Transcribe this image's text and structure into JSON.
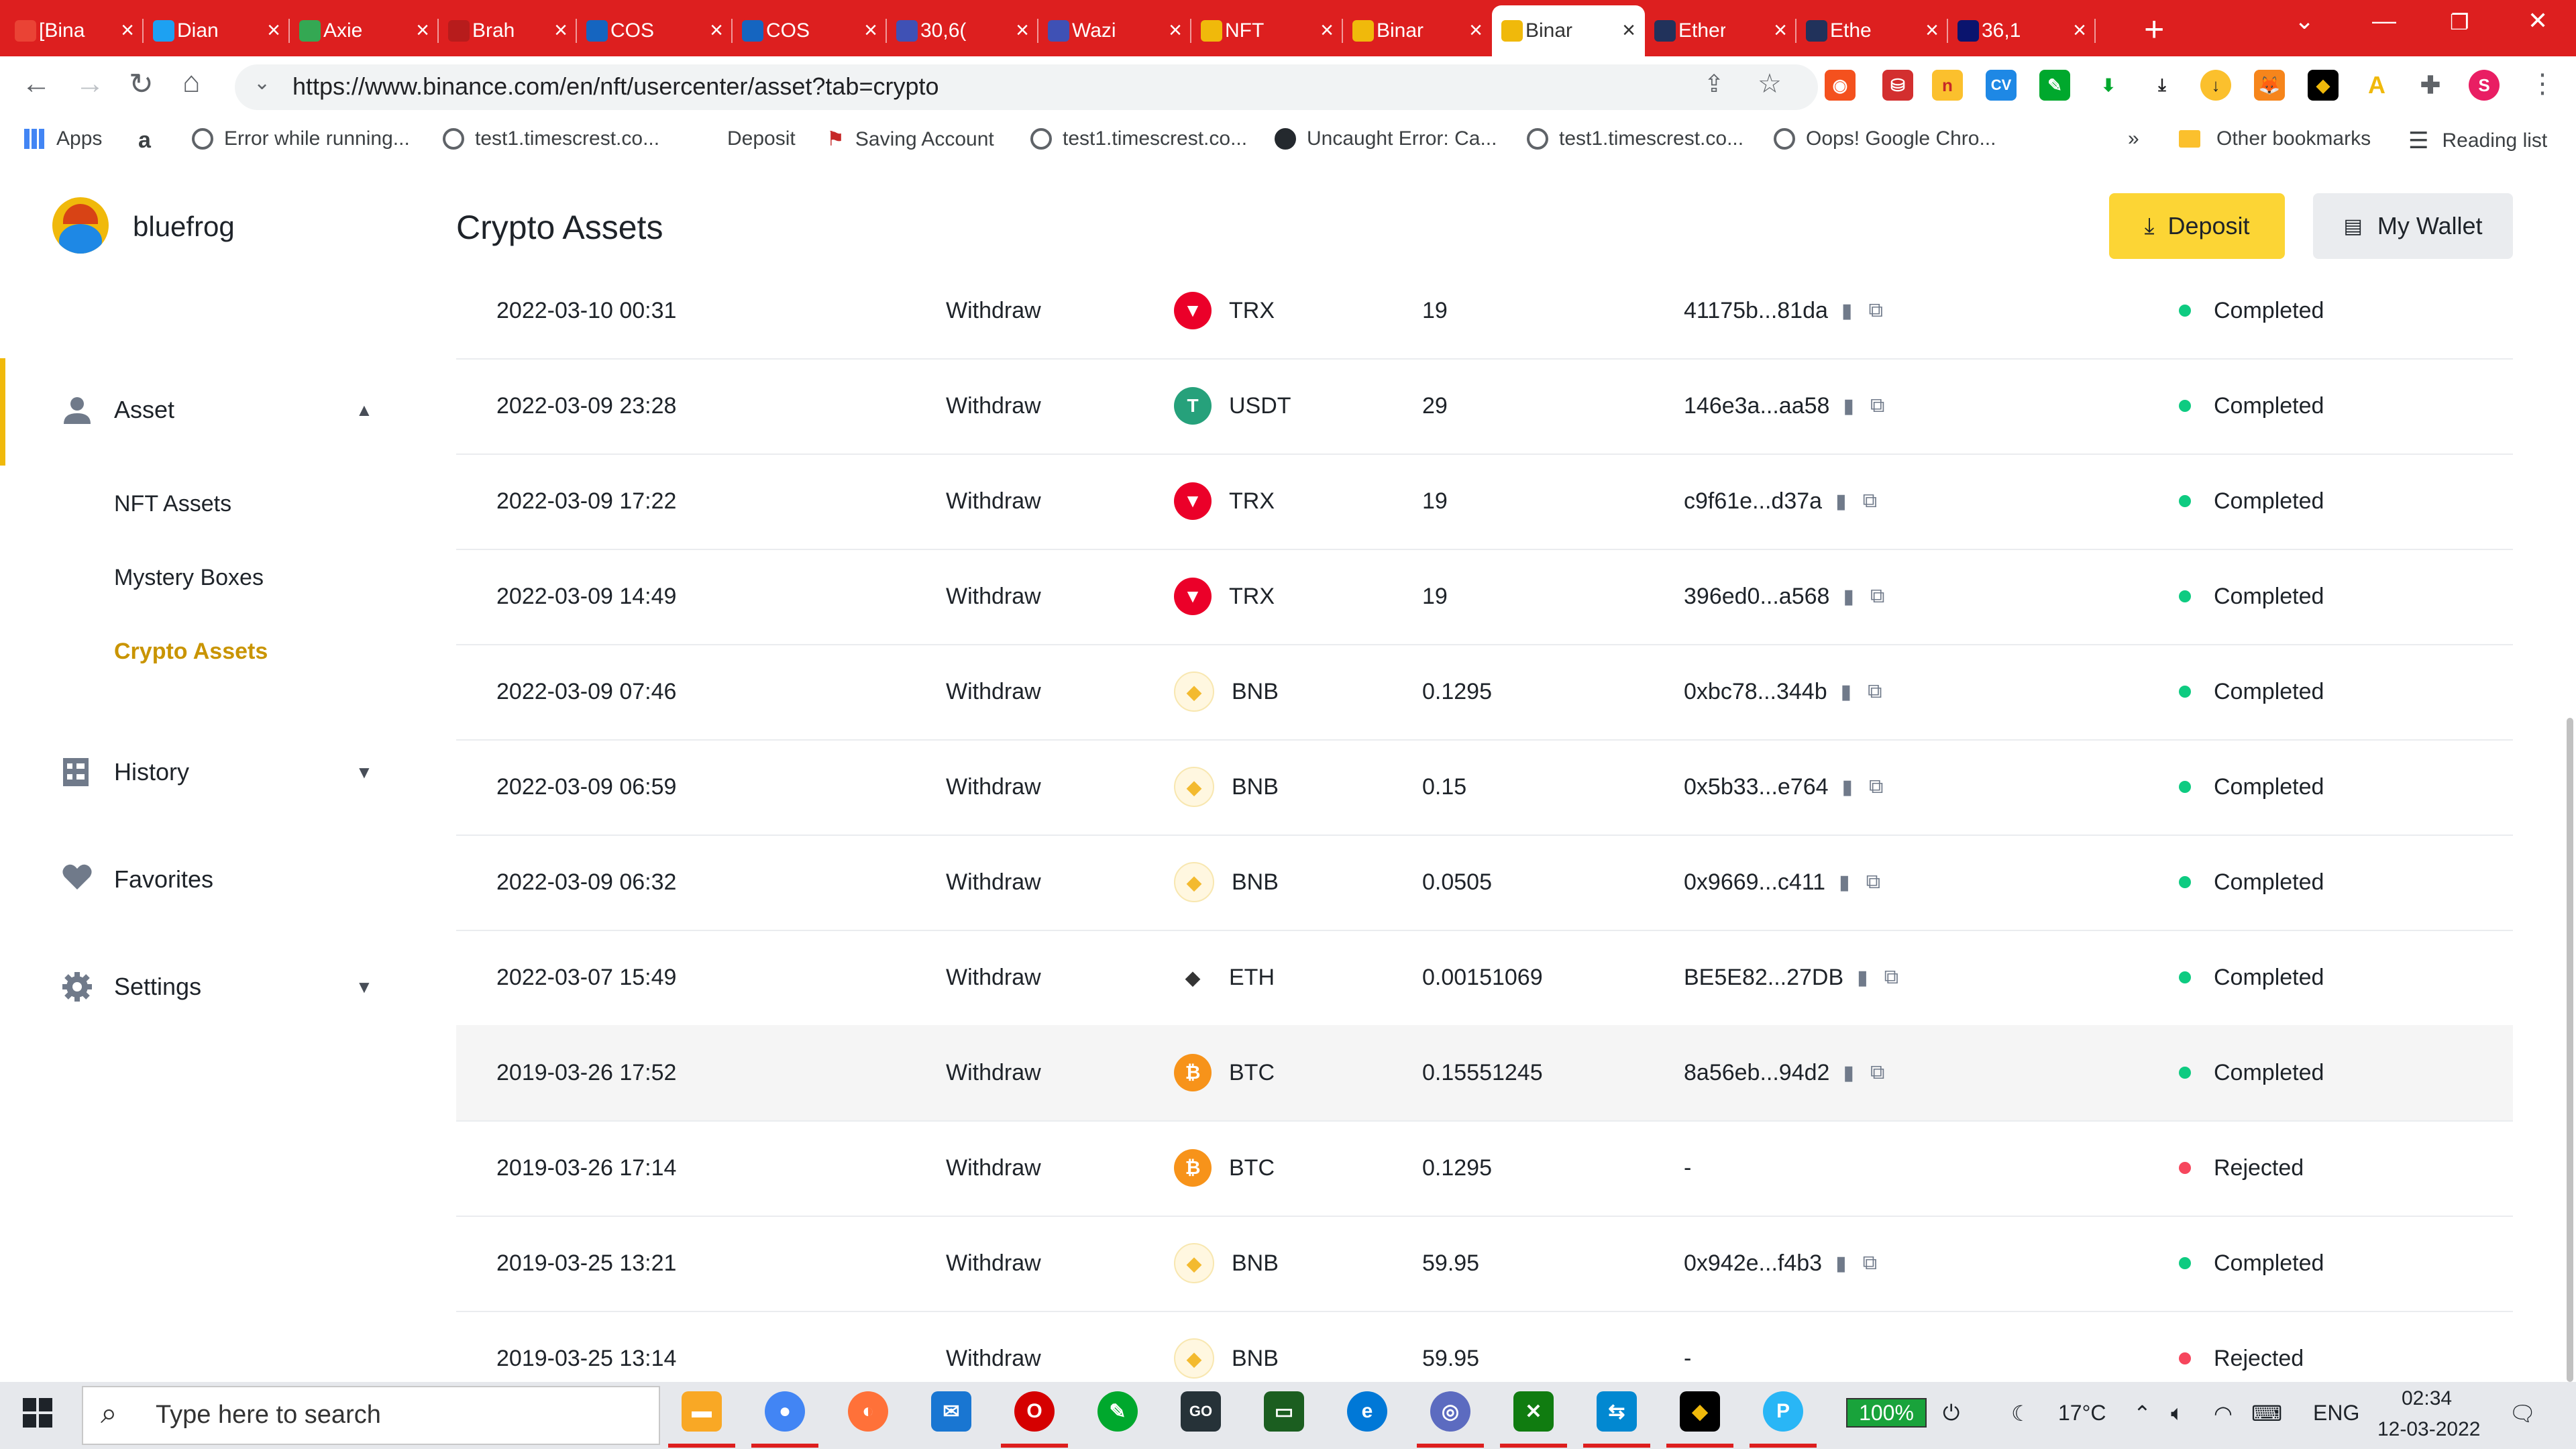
{
  "browser": {
    "tabs": [
      {
        "title": "[Bina",
        "favicon": "gmail-icon",
        "color": "#ea4335"
      },
      {
        "title": "Dian",
        "favicon": "twitter-icon",
        "color": "#1da1f2"
      },
      {
        "title": "Axie",
        "favicon": "drive-icon",
        "color": "#34a853"
      },
      {
        "title": "Brah",
        "favicon": "brahma-icon",
        "color": "#b71c1c"
      },
      {
        "title": "COS",
        "favicon": "cos-icon",
        "color": "#1565c0"
      },
      {
        "title": "COS",
        "favicon": "cos-icon",
        "color": "#1565c0"
      },
      {
        "title": "30,6(",
        "favicon": "wazirx-icon",
        "color": "#3f51b5"
      },
      {
        "title": "Wazi",
        "favicon": "wazirx-icon",
        "color": "#3f51b5"
      },
      {
        "title": "NFT",
        "favicon": "binance-icon",
        "color": "#f0b90b"
      },
      {
        "title": "Binar",
        "favicon": "binance-icon",
        "color": "#f0b90b"
      },
      {
        "title": "Binar",
        "favicon": "binance-icon",
        "color": "#f0b90b"
      },
      {
        "title": "Ether",
        "favicon": "etherscan-icon",
        "color": "#21325b"
      },
      {
        "title": "Ethe",
        "favicon": "etherscan-icon",
        "color": "#21325b"
      },
      {
        "title": "36,1",
        "favicon": "xe-icon",
        "color": "#0a146e"
      }
    ],
    "url": "https://www.binance.com/en/nft/usercenter/asset?tab=crypto",
    "bookmarks": {
      "apps": "Apps",
      "items": [
        "Error while running...",
        "test1.timescrest.co...",
        "Deposit",
        "Saving Account",
        "test1.timescrest.co...",
        "Uncaught Error: Ca...",
        "test1.timescrest.co...",
        "Oops! Google Chro..."
      ],
      "more": "»",
      "other": "Other bookmarks",
      "reading": "Reading list"
    },
    "profile_initial": "S"
  },
  "page": {
    "username": "bluefrog",
    "title": "Crypto Assets",
    "deposit_label": "Deposit",
    "wallet_label": "My Wallet"
  },
  "sidebar": {
    "asset": "Asset",
    "sub": [
      "NFT Assets",
      "Mystery Boxes",
      "Crypto Assets"
    ],
    "history": "History",
    "favorites": "Favorites",
    "settings": "Settings"
  },
  "table": {
    "rows": [
      {
        "date": "2022-03-10 00:31",
        "type": "Withdraw",
        "coin": "TRX",
        "amount": "19",
        "txid": "41175b...81da",
        "status": "Completed"
      },
      {
        "date": "2022-03-09 23:28",
        "type": "Withdraw",
        "coin": "USDT",
        "amount": "29",
        "txid": "146e3a...aa58",
        "status": "Completed"
      },
      {
        "date": "2022-03-09 17:22",
        "type": "Withdraw",
        "coin": "TRX",
        "amount": "19",
        "txid": "c9f61e...d37a",
        "status": "Completed"
      },
      {
        "date": "2022-03-09 14:49",
        "type": "Withdraw",
        "coin": "TRX",
        "amount": "19",
        "txid": "396ed0...a568",
        "status": "Completed"
      },
      {
        "date": "2022-03-09 07:46",
        "type": "Withdraw",
        "coin": "BNB",
        "amount": "0.1295",
        "txid": "0xbc78...344b",
        "status": "Completed"
      },
      {
        "date": "2022-03-09 06:59",
        "type": "Withdraw",
        "coin": "BNB",
        "amount": "0.15",
        "txid": "0x5b33...e764",
        "status": "Completed"
      },
      {
        "date": "2022-03-09 06:32",
        "type": "Withdraw",
        "coin": "BNB",
        "amount": "0.0505",
        "txid": "0x9669...c411",
        "status": "Completed"
      },
      {
        "date": "2022-03-07 15:49",
        "type": "Withdraw",
        "coin": "ETH",
        "amount": "0.00151069",
        "txid": "BE5E82...27DB",
        "status": "Completed"
      },
      {
        "date": "2019-03-26 17:52",
        "type": "Withdraw",
        "coin": "BTC",
        "amount": "0.15551245",
        "txid": "8a56eb...94d2",
        "status": "Completed"
      },
      {
        "date": "2019-03-26 17:14",
        "type": "Withdraw",
        "coin": "BTC",
        "amount": "0.1295",
        "txid": "-",
        "status": "Rejected"
      },
      {
        "date": "2019-03-25 13:21",
        "type": "Withdraw",
        "coin": "BNB",
        "amount": "59.95",
        "txid": "0x942e...f4b3",
        "status": "Completed"
      },
      {
        "date": "2019-03-25 13:14",
        "type": "Withdraw",
        "coin": "BNB",
        "amount": "59.95",
        "txid": "-",
        "status": "Rejected"
      }
    ],
    "coin_colors": {
      "TRX": "#eb0029",
      "USDT": "#26a17b",
      "BNB": "#f3ba2f",
      "ETH": "#343434",
      "BTC": "#f7931a"
    },
    "status_colors": {
      "Completed": "#0ecb81",
      "Rejected": "#f6465d"
    }
  },
  "taskbar": {
    "search_placeholder": "Type here to search",
    "battery": "100%",
    "temperature": "17°C",
    "language": "ENG",
    "time": "02:34",
    "date": "12-03-2022"
  }
}
